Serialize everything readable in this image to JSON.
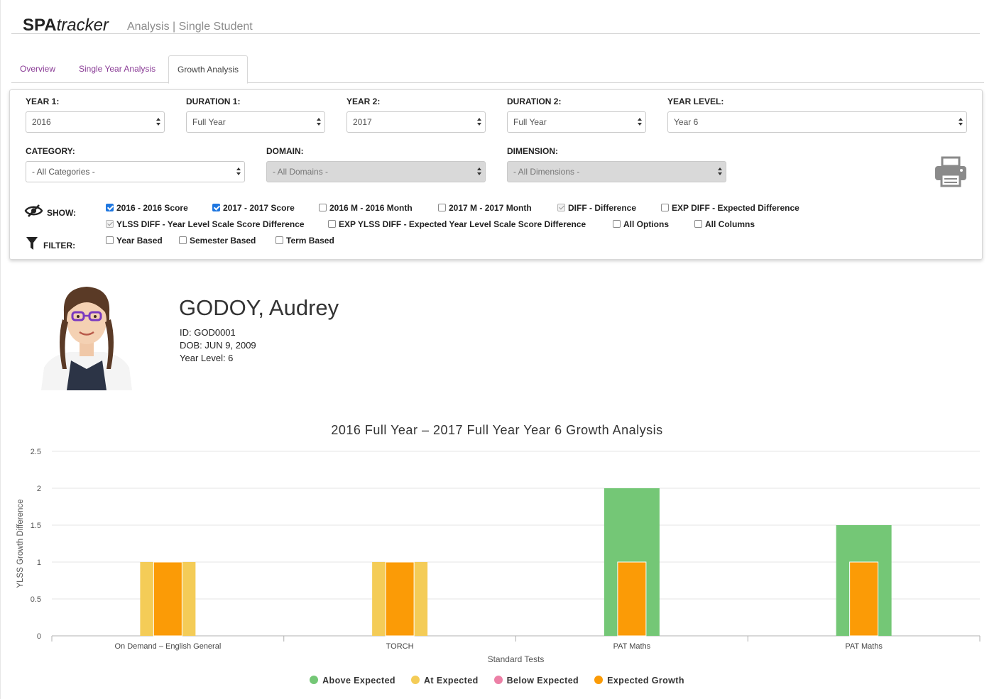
{
  "header": {
    "brand_bold": "SPA",
    "brand_italic": "tracker",
    "subtitle": "Analysis | Single Student"
  },
  "tabs": [
    {
      "label": "Overview",
      "active": false
    },
    {
      "label": "Single Year Analysis",
      "active": false
    },
    {
      "label": "Growth Analysis",
      "active": true
    }
  ],
  "filters": {
    "year1": {
      "label": "YEAR 1:",
      "value": "2016"
    },
    "duration1": {
      "label": "DURATION 1:",
      "value": "Full Year"
    },
    "year2": {
      "label": "YEAR 2:",
      "value": "2017"
    },
    "duration2": {
      "label": "DURATION 2:",
      "value": "Full Year"
    },
    "year_level": {
      "label": "YEAR LEVEL:",
      "value": "Year 6"
    },
    "category": {
      "label": "CATEGORY:",
      "value": "- All Categories -"
    },
    "domain": {
      "label": "DOMAIN:",
      "value": "- All Domains -"
    },
    "dimension": {
      "label": "DIMENSION:",
      "value": "- All Dimensions -"
    }
  },
  "show": {
    "label": "SHOW:",
    "options": [
      {
        "label": "2016 - 2016 Score",
        "state": "checked"
      },
      {
        "label": "2017 - 2017 Score",
        "state": "checked"
      },
      {
        "label": "2016 M - 2016 Month",
        "state": "unchecked"
      },
      {
        "label": "2017 M - 2017 Month",
        "state": "unchecked"
      },
      {
        "label": "DIFF - Difference",
        "state": "disabled-checked"
      },
      {
        "label": "EXP DIFF - Expected Difference",
        "state": "unchecked"
      },
      {
        "label": "YLSS DIFF - Year Level Scale Score Difference",
        "state": "disabled-checked"
      },
      {
        "label": "EXP YLSS DIFF - Expected Year Level Scale Score Difference",
        "state": "unchecked"
      },
      {
        "label": "All Options",
        "state": "unchecked"
      },
      {
        "label": "All Columns",
        "state": "unchecked"
      }
    ]
  },
  "filter": {
    "label": "FILTER:",
    "options": [
      {
        "label": "Year Based",
        "state": "unchecked"
      },
      {
        "label": "Semester Based",
        "state": "unchecked"
      },
      {
        "label": "Term Based",
        "state": "unchecked"
      }
    ]
  },
  "student": {
    "name": "GODOY, Audrey",
    "id": "ID: GOD0001",
    "dob": "DOB: JUN 9, 2009",
    "year_level": "Year Level: 6"
  },
  "icons": {
    "show": "eye-slash-icon",
    "filter": "funnel-icon",
    "print": "printer-icon"
  },
  "colors": {
    "above": "#74c776",
    "at": "#f4cc57",
    "below": "#ec80a6",
    "expected": "#fb9b06",
    "tab_link": "#8a3c96",
    "checkbox": "#1f77e0"
  },
  "chart_data": {
    "type": "bar",
    "title": "2016 Full Year – 2017 Full Year Year 6 Growth Analysis",
    "xlabel": "Standard Tests",
    "ylabel": "YLSS Growth Difference",
    "ylim": [
      0,
      2.5
    ],
    "yticks": [
      "0",
      "0.5",
      "1",
      "1.5",
      "2",
      "2.5"
    ],
    "categories": [
      "On Demand – English General",
      "TORCH",
      "PAT Maths",
      "PAT Maths"
    ],
    "series": [
      {
        "name": "Growth",
        "values": [
          1,
          1,
          2,
          1.5
        ],
        "status": [
          "at",
          "at",
          "above",
          "above"
        ]
      },
      {
        "name": "Expected Growth",
        "values": [
          1,
          1,
          1,
          1
        ]
      }
    ],
    "legend": [
      {
        "label": "Above Expected",
        "color": "#74c776"
      },
      {
        "label": "At Expected",
        "color": "#f4cc57"
      },
      {
        "label": "Below Expected",
        "color": "#ec80a6"
      },
      {
        "label": "Expected Growth",
        "color": "#fb9b06"
      }
    ],
    "grid": true,
    "legend_position": "bottom"
  }
}
